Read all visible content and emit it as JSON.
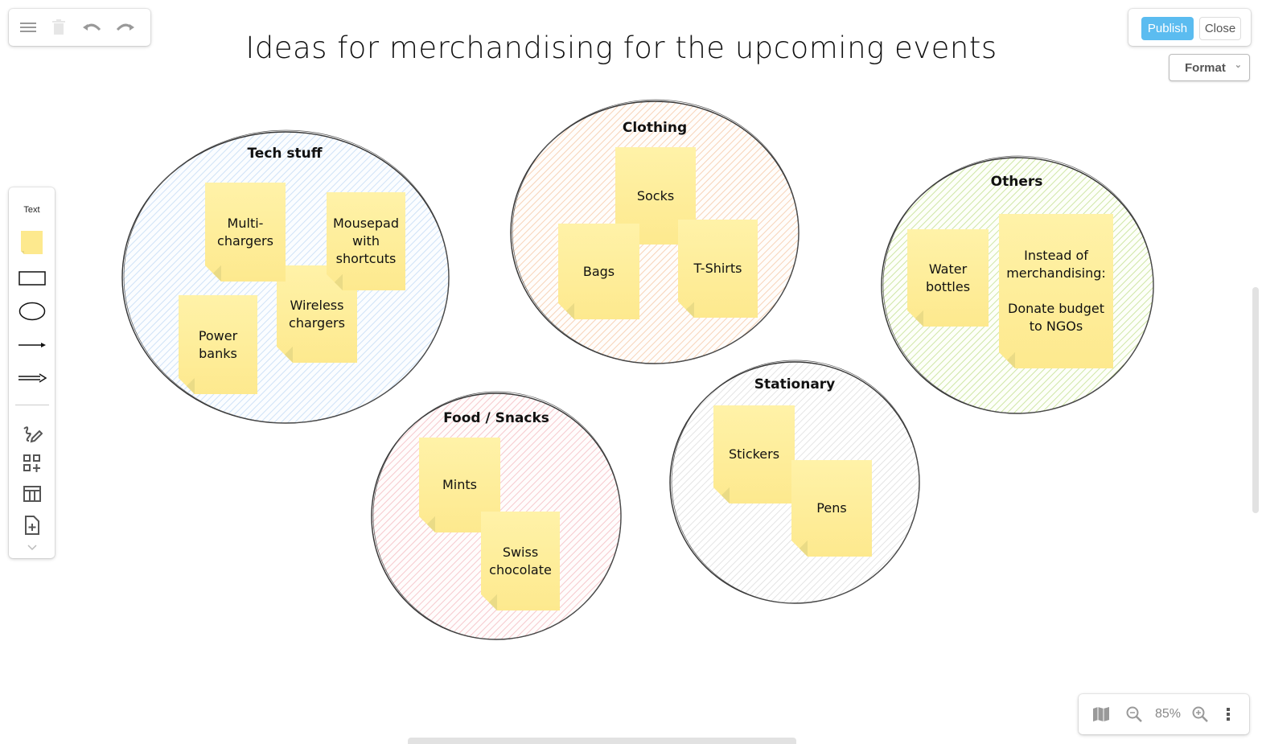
{
  "toolbar": {
    "menu_icon": "hamburger-menu-icon",
    "delete_icon": "trash-icon",
    "undo_icon": "undo-icon",
    "redo_icon": "redo-icon"
  },
  "actions": {
    "publish_label": "Publish",
    "close_label": "Close",
    "format_label": "Format"
  },
  "shapes_panel": {
    "text_label": "Text",
    "items": [
      "sticky-note",
      "rectangle",
      "ellipse",
      "arrow",
      "double-arrow",
      "freehand",
      "more-shapes",
      "table",
      "insert-page"
    ]
  },
  "zoom": {
    "level": "85%"
  },
  "board": {
    "title": "Ideas for merchandising for the upcoming events",
    "clusters": [
      {
        "label": "Tech stuff",
        "color": "#cfe2f7",
        "notes": [
          "Multi-\nchargers",
          "Mousepad\nwith\nshortcuts",
          "Wireless\nchargers",
          "Power\nbanks"
        ]
      },
      {
        "label": "Clothing",
        "color": "#f7d3b8",
        "notes": [
          "Socks",
          "Bags",
          "T-Shirts"
        ]
      },
      {
        "label": "Others",
        "color": "#cfe6a6",
        "notes": [
          "Water\nbottles",
          "Instead of\nmerchandising:\n\nDonate budget\nto NGOs"
        ]
      },
      {
        "label": "Food / Snacks",
        "color": "#f6c9cd",
        "notes": [
          "Mints",
          "Swiss\nchocolate"
        ]
      },
      {
        "label": "Stationary",
        "color": "#dcdcdc",
        "notes": [
          "Stickers",
          "Pens"
        ]
      }
    ]
  }
}
